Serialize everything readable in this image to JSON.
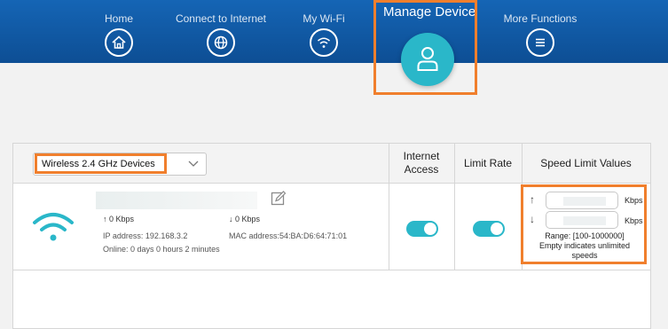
{
  "nav": {
    "items": [
      {
        "label": "Home",
        "icon": "home-icon"
      },
      {
        "label": "Connect to Internet",
        "icon": "globe-icon"
      },
      {
        "label": "My Wi-Fi",
        "icon": "wifi-icon"
      },
      {
        "label": "Manage Device",
        "icon": "user-icon",
        "active": true
      },
      {
        "label": "More Functions",
        "icon": "menu-icon"
      }
    ]
  },
  "colors": {
    "header": "#1565b5",
    "accent": "#2ab7c9",
    "highlight": "#f07f2d"
  },
  "table": {
    "filter": {
      "selected": "Wireless 2.4 GHz Devices"
    },
    "headers": {
      "internet_access": "Internet Access",
      "limit_rate": "Limit Rate",
      "speed_limit_values": "Speed Limit Values"
    },
    "device": {
      "icon": "wifi-signal-icon",
      "upload": "↑ 0 Kbps",
      "download": "↓ 0 Kbps",
      "ip": "IP address: 192.168.3.2",
      "mac": "MAC address:54:BA:D6:64:71:01",
      "online": "Online: 0 days 0 hours 2 minutes",
      "internet_access": true,
      "limit_rate": true
    },
    "speed": {
      "up_arrow": "↑",
      "down_arrow": "↓",
      "unit": "Kbps",
      "range": "Range: [100-1000000]",
      "note_line1": "Empty indicates unlimited",
      "note_line2": "speeds"
    }
  }
}
